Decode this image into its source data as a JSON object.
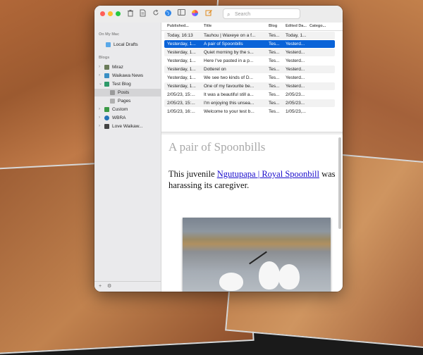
{
  "toolbar": {
    "search_placeholder": "Search",
    "icons": [
      "trash-icon",
      "document-icon",
      "refresh-icon",
      "globe-icon",
      "sidebar-icon",
      "color-wheel-icon",
      "compose-icon"
    ]
  },
  "sidebar": {
    "section_mac": "On My Mac",
    "local_drafts": "Local Drafts",
    "section_blogs": "Blogs",
    "blogs": [
      {
        "label": "Miraz"
      },
      {
        "label": "Waikawa News"
      },
      {
        "label": "Test Blog"
      },
      {
        "label": "Posts"
      },
      {
        "label": "Pages"
      },
      {
        "label": "Custom"
      },
      {
        "label": "WBRA"
      },
      {
        "label": "Love Waikaw..."
      }
    ],
    "bottom_add": "+",
    "bottom_gear": "⚙︎"
  },
  "list": {
    "headers": [
      "Published...",
      "Title",
      "Blog",
      "Edited Da...",
      "Catego..."
    ],
    "rows": [
      {
        "published": "Today, 16:13",
        "title": "Tauhou | Waxeye on a f...",
        "blog": "Tes...",
        "edited": "Today, 1..."
      },
      {
        "published": "Yesterday, 1...",
        "title": "A pair of Spoonbills",
        "blog": "Tes...",
        "edited": "Yesterd..."
      },
      {
        "published": "Yesterday, 1...",
        "title": "Quiet morning by the s...",
        "blog": "Tes...",
        "edited": "Yesterd..."
      },
      {
        "published": "Yesterday, 1...",
        "title": "Here I've pasted in a p...",
        "blog": "Tes...",
        "edited": "Yesterd..."
      },
      {
        "published": "Yesterday, 1...",
        "title": "Dotterel on",
        "blog": "Tes...",
        "edited": "Yesterd..."
      },
      {
        "published": "Yesterday, 1...",
        "title": "We see two kinds of D...",
        "blog": "Tes...",
        "edited": "Yesterd..."
      },
      {
        "published": "Yesterday, 1...",
        "title": "One of my favourite be...",
        "blog": "Tes...",
        "edited": "Yesterd..."
      },
      {
        "published": "2/05/23, 15:...",
        "title": "It was a beautiful still a...",
        "blog": "Tes...",
        "edited": "2/05/23..."
      },
      {
        "published": "2/05/23, 15:...",
        "title": "I'm enjoying this unsea...",
        "blog": "Tes...",
        "edited": "2/05/23..."
      },
      {
        "published": "1/05/23, 16:...",
        "title": "Welcome to your test b...",
        "blog": "Tes...",
        "edited": "1/05/23,..."
      }
    ],
    "selected_index": 1
  },
  "preview": {
    "title": "A pair of Spoonbills",
    "text_before": "This juvenile ",
    "link_text": "Ngutupapa | Royal Spoonbill",
    "text_after": " was harassing its caregiver."
  },
  "colors": {
    "selection": "#0a63d8",
    "link": "#1a0dcc"
  }
}
